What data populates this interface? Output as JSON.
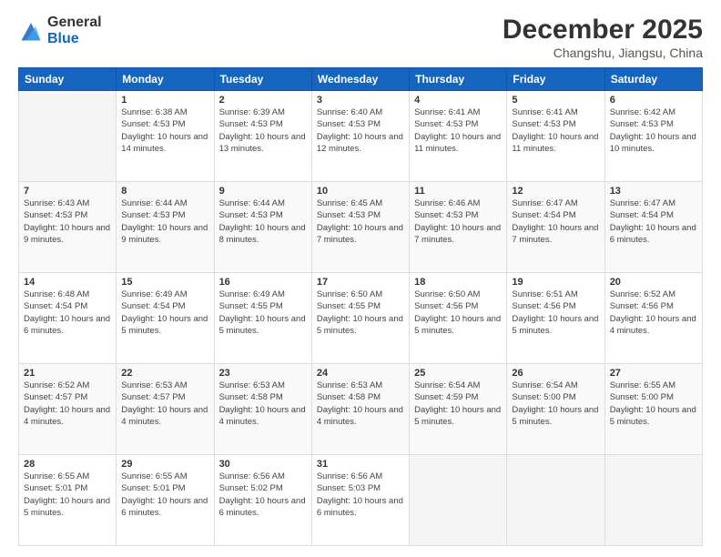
{
  "logo": {
    "general": "General",
    "blue": "Blue"
  },
  "header": {
    "month": "December 2025",
    "location": "Changshu, Jiangsu, China"
  },
  "days_of_week": [
    "Sunday",
    "Monday",
    "Tuesday",
    "Wednesday",
    "Thursday",
    "Friday",
    "Saturday"
  ],
  "weeks": [
    [
      {
        "day": "",
        "sunrise": "",
        "sunset": "",
        "daylight": ""
      },
      {
        "day": "1",
        "sunrise": "Sunrise: 6:38 AM",
        "sunset": "Sunset: 4:53 PM",
        "daylight": "Daylight: 10 hours and 14 minutes."
      },
      {
        "day": "2",
        "sunrise": "Sunrise: 6:39 AM",
        "sunset": "Sunset: 4:53 PM",
        "daylight": "Daylight: 10 hours and 13 minutes."
      },
      {
        "day": "3",
        "sunrise": "Sunrise: 6:40 AM",
        "sunset": "Sunset: 4:53 PM",
        "daylight": "Daylight: 10 hours and 12 minutes."
      },
      {
        "day": "4",
        "sunrise": "Sunrise: 6:41 AM",
        "sunset": "Sunset: 4:53 PM",
        "daylight": "Daylight: 10 hours and 11 minutes."
      },
      {
        "day": "5",
        "sunrise": "Sunrise: 6:41 AM",
        "sunset": "Sunset: 4:53 PM",
        "daylight": "Daylight: 10 hours and 11 minutes."
      },
      {
        "day": "6",
        "sunrise": "Sunrise: 6:42 AM",
        "sunset": "Sunset: 4:53 PM",
        "daylight": "Daylight: 10 hours and 10 minutes."
      }
    ],
    [
      {
        "day": "7",
        "sunrise": "Sunrise: 6:43 AM",
        "sunset": "Sunset: 4:53 PM",
        "daylight": "Daylight: 10 hours and 9 minutes."
      },
      {
        "day": "8",
        "sunrise": "Sunrise: 6:44 AM",
        "sunset": "Sunset: 4:53 PM",
        "daylight": "Daylight: 10 hours and 9 minutes."
      },
      {
        "day": "9",
        "sunrise": "Sunrise: 6:44 AM",
        "sunset": "Sunset: 4:53 PM",
        "daylight": "Daylight: 10 hours and 8 minutes."
      },
      {
        "day": "10",
        "sunrise": "Sunrise: 6:45 AM",
        "sunset": "Sunset: 4:53 PM",
        "daylight": "Daylight: 10 hours and 7 minutes."
      },
      {
        "day": "11",
        "sunrise": "Sunrise: 6:46 AM",
        "sunset": "Sunset: 4:53 PM",
        "daylight": "Daylight: 10 hours and 7 minutes."
      },
      {
        "day": "12",
        "sunrise": "Sunrise: 6:47 AM",
        "sunset": "Sunset: 4:54 PM",
        "daylight": "Daylight: 10 hours and 7 minutes."
      },
      {
        "day": "13",
        "sunrise": "Sunrise: 6:47 AM",
        "sunset": "Sunset: 4:54 PM",
        "daylight": "Daylight: 10 hours and 6 minutes."
      }
    ],
    [
      {
        "day": "14",
        "sunrise": "Sunrise: 6:48 AM",
        "sunset": "Sunset: 4:54 PM",
        "daylight": "Daylight: 10 hours and 6 minutes."
      },
      {
        "day": "15",
        "sunrise": "Sunrise: 6:49 AM",
        "sunset": "Sunset: 4:54 PM",
        "daylight": "Daylight: 10 hours and 5 minutes."
      },
      {
        "day": "16",
        "sunrise": "Sunrise: 6:49 AM",
        "sunset": "Sunset: 4:55 PM",
        "daylight": "Daylight: 10 hours and 5 minutes."
      },
      {
        "day": "17",
        "sunrise": "Sunrise: 6:50 AM",
        "sunset": "Sunset: 4:55 PM",
        "daylight": "Daylight: 10 hours and 5 minutes."
      },
      {
        "day": "18",
        "sunrise": "Sunrise: 6:50 AM",
        "sunset": "Sunset: 4:56 PM",
        "daylight": "Daylight: 10 hours and 5 minutes."
      },
      {
        "day": "19",
        "sunrise": "Sunrise: 6:51 AM",
        "sunset": "Sunset: 4:56 PM",
        "daylight": "Daylight: 10 hours and 5 minutes."
      },
      {
        "day": "20",
        "sunrise": "Sunrise: 6:52 AM",
        "sunset": "Sunset: 4:56 PM",
        "daylight": "Daylight: 10 hours and 4 minutes."
      }
    ],
    [
      {
        "day": "21",
        "sunrise": "Sunrise: 6:52 AM",
        "sunset": "Sunset: 4:57 PM",
        "daylight": "Daylight: 10 hours and 4 minutes."
      },
      {
        "day": "22",
        "sunrise": "Sunrise: 6:53 AM",
        "sunset": "Sunset: 4:57 PM",
        "daylight": "Daylight: 10 hours and 4 minutes."
      },
      {
        "day": "23",
        "sunrise": "Sunrise: 6:53 AM",
        "sunset": "Sunset: 4:58 PM",
        "daylight": "Daylight: 10 hours and 4 minutes."
      },
      {
        "day": "24",
        "sunrise": "Sunrise: 6:53 AM",
        "sunset": "Sunset: 4:58 PM",
        "daylight": "Daylight: 10 hours and 4 minutes."
      },
      {
        "day": "25",
        "sunrise": "Sunrise: 6:54 AM",
        "sunset": "Sunset: 4:59 PM",
        "daylight": "Daylight: 10 hours and 5 minutes."
      },
      {
        "day": "26",
        "sunrise": "Sunrise: 6:54 AM",
        "sunset": "Sunset: 5:00 PM",
        "daylight": "Daylight: 10 hours and 5 minutes."
      },
      {
        "day": "27",
        "sunrise": "Sunrise: 6:55 AM",
        "sunset": "Sunset: 5:00 PM",
        "daylight": "Daylight: 10 hours and 5 minutes."
      }
    ],
    [
      {
        "day": "28",
        "sunrise": "Sunrise: 6:55 AM",
        "sunset": "Sunset: 5:01 PM",
        "daylight": "Daylight: 10 hours and 5 minutes."
      },
      {
        "day": "29",
        "sunrise": "Sunrise: 6:55 AM",
        "sunset": "Sunset: 5:01 PM",
        "daylight": "Daylight: 10 hours and 6 minutes."
      },
      {
        "day": "30",
        "sunrise": "Sunrise: 6:56 AM",
        "sunset": "Sunset: 5:02 PM",
        "daylight": "Daylight: 10 hours and 6 minutes."
      },
      {
        "day": "31",
        "sunrise": "Sunrise: 6:56 AM",
        "sunset": "Sunset: 5:03 PM",
        "daylight": "Daylight: 10 hours and 6 minutes."
      },
      {
        "day": "",
        "sunrise": "",
        "sunset": "",
        "daylight": ""
      },
      {
        "day": "",
        "sunrise": "",
        "sunset": "",
        "daylight": ""
      },
      {
        "day": "",
        "sunrise": "",
        "sunset": "",
        "daylight": ""
      }
    ]
  ]
}
